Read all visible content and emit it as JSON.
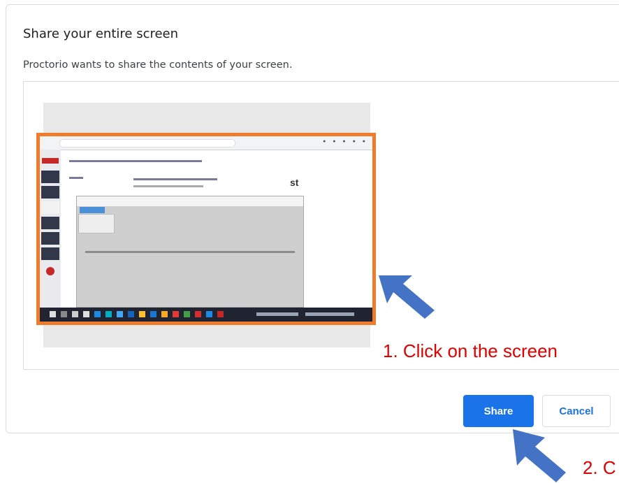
{
  "dialog": {
    "title": "Share your entire screen",
    "subtitle": "Proctorio wants to share the contents of your screen.",
    "thumbnail": {
      "right_text": "st",
      "selected": true,
      "selection_color": "#ef7b2c"
    },
    "share_label": "Share",
    "cancel_label": "Cancel",
    "accent_color": "#1a73e8"
  },
  "annotations": {
    "step1": "1.  Click on the screen",
    "step2": "2.  C",
    "arrow_color": "#4472c4",
    "text_color": "#e00000"
  }
}
